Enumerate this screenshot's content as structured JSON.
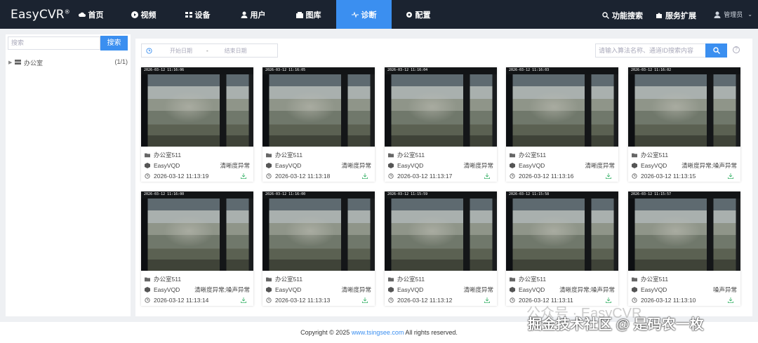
{
  "header": {
    "logo": "EasyCVR",
    "logo_mark": "®",
    "nav": [
      {
        "label": "首页",
        "icon": "cloud-icon"
      },
      {
        "label": "视频",
        "icon": "play-icon"
      },
      {
        "label": "设备",
        "icon": "devices-icon"
      },
      {
        "label": "用户",
        "icon": "user-icon"
      },
      {
        "label": "图库",
        "icon": "gallery-icon"
      },
      {
        "label": "诊断",
        "icon": "diagnose-icon",
        "active": true
      },
      {
        "label": "配置",
        "icon": "gear-icon"
      }
    ],
    "search_label": "功能搜索",
    "extension_label": "服务扩展",
    "user_label": "管理员"
  },
  "sidebar": {
    "search_placeholder": "搜索",
    "search_button": "搜索",
    "tree": [
      {
        "label": "办公室",
        "count": "(1/1)"
      }
    ]
  },
  "filters": {
    "start_placeholder": "开始日期",
    "separator": "-",
    "end_placeholder": "结束日期",
    "keyword_placeholder": "请输入算法名称、通道ID搜索内容"
  },
  "cards": [
    {
      "ts": "2026-03-12  11:16:06",
      "name": "办公室511",
      "algo": "EasyVQD",
      "result": "清晰度异常",
      "time": "2026-03-12 11:13:19"
    },
    {
      "ts": "2026-03-12  11:16:05",
      "name": "办公室511",
      "algo": "EasyVQD",
      "result": "清晰度异常",
      "time": "2026-03-12 11:13:18"
    },
    {
      "ts": "2026-03-12  11:16:04",
      "name": "办公室511",
      "algo": "EasyVQD",
      "result": "清晰度异常",
      "time": "2026-03-12 11:13:17"
    },
    {
      "ts": "2026-03-12  11:16:03",
      "name": "办公室511",
      "algo": "EasyVQD",
      "result": "清晰度异常",
      "time": "2026-03-12 11:13:16"
    },
    {
      "ts": "2026-03-12  11:16:02",
      "name": "办公室511",
      "algo": "EasyVQD",
      "result": "清晰度异常;噪声异常",
      "time": "2026-03-12 11:13:15"
    },
    {
      "ts": "2026-03-12  11:16:00",
      "name": "办公室511",
      "algo": "EasyVQD",
      "result": "清晰度异常;噪声异常",
      "time": "2026-03-12 11:13:14"
    },
    {
      "ts": "2026-03-12  11:16:00",
      "name": "办公室511",
      "algo": "EasyVQD",
      "result": "清晰度异常",
      "time": "2026-03-12 11:13:13"
    },
    {
      "ts": "2026-03-12  11:15:59",
      "name": "办公室511",
      "algo": "EasyVQD",
      "result": "清晰度异常",
      "time": "2026-03-12 11:13:12"
    },
    {
      "ts": "2026-03-12  11:15:58",
      "name": "办公室511",
      "algo": "EasyVQD",
      "result": "清晰度异常;噪声异常",
      "time": "2026-03-12 11:13:11"
    },
    {
      "ts": "2026-03-12  11:15:57",
      "name": "办公室511",
      "algo": "EasyVQD",
      "result": "噪声异常",
      "time": "2026-03-12 11:13:10"
    }
  ],
  "footer": {
    "prefix": "Copyright © 2025 ",
    "link": "www.tsingsee.com",
    "suffix": " All rights reserved."
  },
  "watermark": {
    "line1": "公众号 · EasyCVR",
    "line2": "掘金技术社区 @ 是码农一枚"
  },
  "colors": {
    "accent": "#3b8ff0",
    "header_bg": "#1b2330",
    "success": "#3bb36a"
  }
}
